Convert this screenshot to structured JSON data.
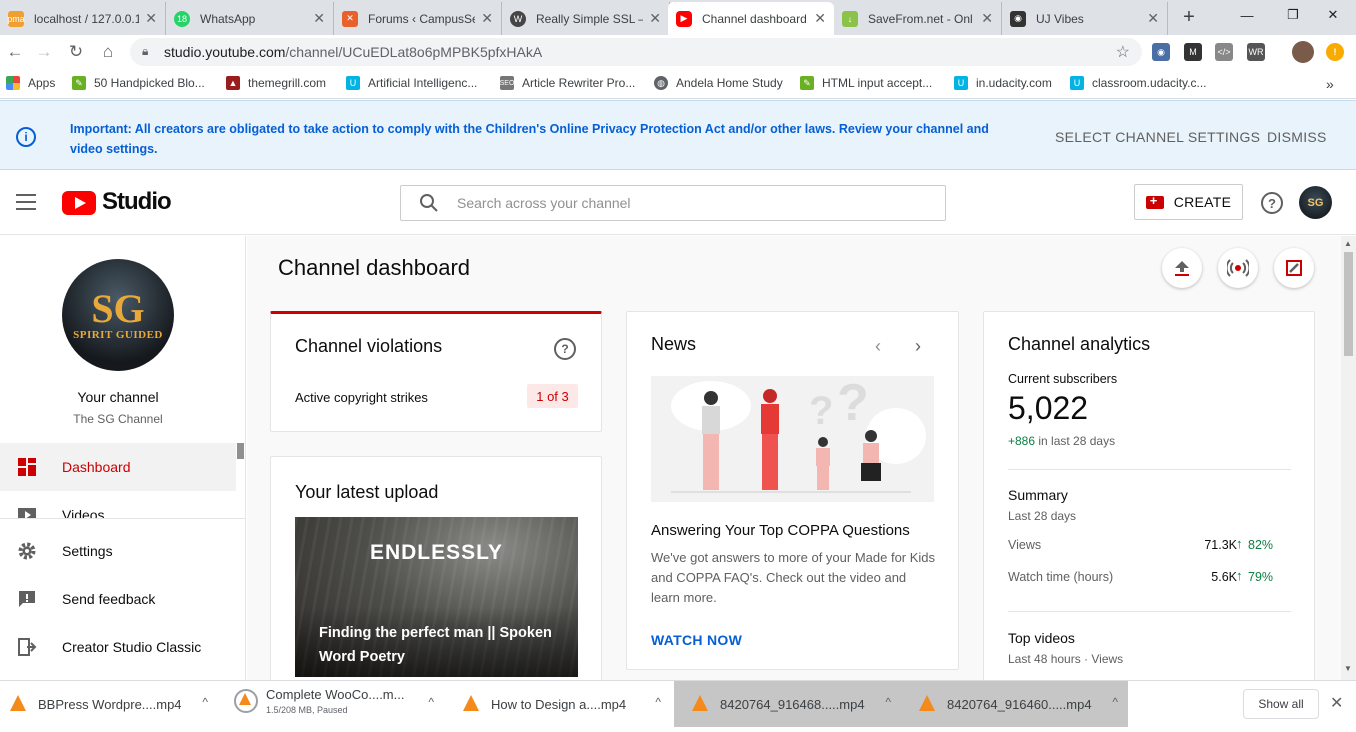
{
  "browser": {
    "tabs": [
      {
        "title": "localhost / 127.0.0.1",
        "icon": "phpmyadmin-icon",
        "color": "#f0a030"
      },
      {
        "title": "WhatsApp",
        "icon": "whatsapp-icon",
        "color": "#25d366",
        "badge": "18"
      },
      {
        "title": "Forums ‹ CampusSell",
        "icon": "campus-icon",
        "color": "#e8612c"
      },
      {
        "title": "Really Simple SSL –",
        "icon": "wordpress-icon",
        "color": "#464646"
      },
      {
        "title": "Channel dashboard",
        "icon": "youtube-icon",
        "color": "#ff0000"
      },
      {
        "title": "SaveFrom.net - Onl",
        "icon": "savefrom-icon",
        "color": "#8bc34a"
      },
      {
        "title": "UJ Vibes",
        "icon": "ujvibes-icon",
        "color": "#333333"
      }
    ],
    "new_tab": "+",
    "url_host": "studio.youtube.com",
    "url_path": "/channel/UCuEDLat8o6pMPBK5pfxHAkA",
    "bookmarks": [
      {
        "label": "Apps",
        "icon": "apps-grid-icon",
        "color": "#e8453c"
      },
      {
        "label": "50 Handpicked Blo...",
        "icon": "bookmark-icon",
        "color": "#6ab023"
      },
      {
        "label": "themegrill.com",
        "icon": "themegrill-icon",
        "color": "#9b1c1c"
      },
      {
        "label": "Artificial Intelligenc...",
        "icon": "udacity-icon",
        "color": "#02b3e4"
      },
      {
        "label": "Article Rewriter Pro...",
        "icon": "seo-icon",
        "color": "#777777"
      },
      {
        "label": "Andela Home Study",
        "icon": "globe-icon",
        "color": "#5f6368"
      },
      {
        "label": "HTML input accept...",
        "icon": "bookmark-icon",
        "color": "#6ab023"
      },
      {
        "label": "in.udacity.com",
        "icon": "udacity-icon",
        "color": "#02b3e4"
      },
      {
        "label": "classroom.udacity.c...",
        "icon": "udacity-icon",
        "color": "#02b3e4"
      }
    ],
    "more_bookmarks": "»"
  },
  "banner": {
    "message": "Important: All creators are obligated to take action to comply with the Children's Online Privacy Protection Act and/or other laws. Review your channel and video settings.",
    "action_primary": "SELECT CHANNEL SETTINGS",
    "action_dismiss": "DISMISS"
  },
  "header": {
    "logo_text": "Studio",
    "search_placeholder": "Search across your channel",
    "create_label": "CREATE",
    "avatar_initials": "SG"
  },
  "sidebar": {
    "channel_avatar_big": "SG",
    "channel_avatar_small": "SPIRIT GUIDED",
    "your_channel": "Your channel",
    "channel_name": "The SG Channel",
    "nav": [
      {
        "label": "Dashboard",
        "icon": "dashboard-icon",
        "active": true
      },
      {
        "label": "Videos",
        "icon": "videos-icon",
        "active": false
      }
    ],
    "bottom": [
      {
        "label": "Settings",
        "icon": "gear-icon"
      },
      {
        "label": "Send feedback",
        "icon": "feedback-icon"
      },
      {
        "label": "Creator Studio Classic",
        "icon": "classic-icon"
      }
    ]
  },
  "main": {
    "title": "Channel dashboard",
    "violations": {
      "title": "Channel violations",
      "label": "Active copyright strikes",
      "count": "1 of 3"
    },
    "latest_upload": {
      "title": "Your latest upload",
      "thumb_heading": "ENDLESSLY",
      "video_title": "Finding the perfect man || Spoken Word Poetry"
    },
    "news": {
      "title": "News",
      "headline": "Answering Your Top COPPA Questions",
      "body": "We've got answers to more of your Made for Kids and COPPA FAQ's. Check out the video and learn more.",
      "cta": "WATCH NOW"
    },
    "analytics": {
      "title": "Channel analytics",
      "subs_label": "Current subscribers",
      "subs_value": "5,022",
      "subs_delta": "+886",
      "subs_delta_suffix": "in last 28 days",
      "summary_title": "Summary",
      "summary_period": "Last 28 days",
      "metrics": [
        {
          "label": "Views",
          "value": "71.3K",
          "change": "82%"
        },
        {
          "label": "Watch time (hours)",
          "value": "5.6K",
          "change": "79%"
        }
      ],
      "top_title": "Top videos",
      "top_period": "Last 48 hours · Views"
    }
  },
  "downloads": {
    "items": [
      {
        "name": "BBPress Wordpre....mp4",
        "sub": ""
      },
      {
        "name": "Complete WooCo....m...",
        "sub": "1.5/208 MB, Paused"
      },
      {
        "name": "How to Design a....mp4",
        "sub": ""
      },
      {
        "name": "8420764_916468.....mp4",
        "sub": ""
      },
      {
        "name": "8420764_916460.....mp4",
        "sub": ""
      }
    ],
    "show_all": "Show all"
  },
  "colors": {
    "accent_red": "#cc0000",
    "link_blue": "#065fd4",
    "positive_green": "#0b8043"
  }
}
